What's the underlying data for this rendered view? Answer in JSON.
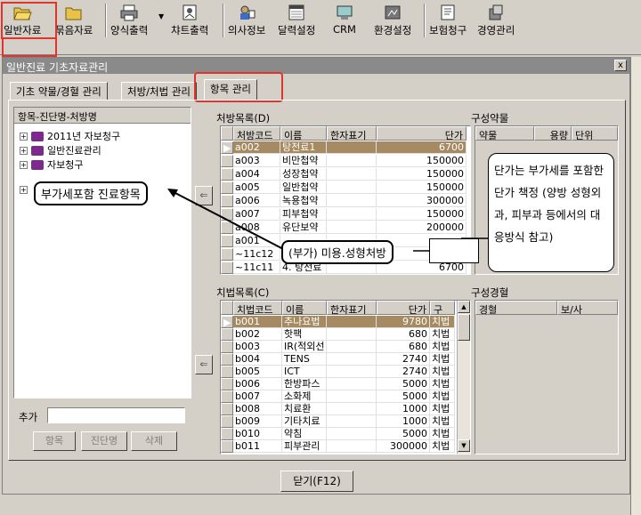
{
  "toolbar": {
    "items": [
      {
        "label": "일반자료",
        "icon": "folder-open-icon"
      },
      {
        "label": "묶음자료",
        "icon": "folder-icon"
      },
      {
        "label": "양식출력",
        "icon": "printer-icon"
      },
      {
        "label": "챠트출력",
        "icon": "chart-print-icon"
      },
      {
        "label": "의사정보",
        "icon": "doctor-icon"
      },
      {
        "label": "달력설정",
        "icon": "calendar-icon"
      },
      {
        "label": "CRM",
        "icon": "crm-icon"
      },
      {
        "label": "환경설정",
        "icon": "settings-icon"
      },
      {
        "label": "보험청구",
        "icon": "insurance-claim-icon"
      },
      {
        "label": "경영관리",
        "icon": "management-icon"
      }
    ]
  },
  "window": {
    "title": "일반진료 기초자료관리",
    "close": "x",
    "tabs": [
      "기초 약물/경혈 관리",
      "처방/처법 관리",
      "항목 관리"
    ],
    "active_tab": "항목 관리",
    "close_button": "닫기(F12)"
  },
  "tree": {
    "header": "항목-진단명-처방명",
    "nodes": [
      "2011년 자보청구",
      "일반진료관리",
      "자보청구"
    ],
    "add_label": "추가",
    "add_value": "",
    "buttons": [
      "항목",
      "진단명",
      "삭제"
    ]
  },
  "prescriptions": {
    "title": "처방목록(D)",
    "columns": [
      "처방코드",
      "이름",
      "한자표기",
      "단가"
    ],
    "rows": [
      {
        "code": "a002",
        "name": "탕전료1",
        "hanja": "",
        "price": "6700"
      },
      {
        "code": "a003",
        "name": "비만첩약",
        "hanja": "",
        "price": "150000"
      },
      {
        "code": "a004",
        "name": "성장첩약",
        "hanja": "",
        "price": "150000"
      },
      {
        "code": "a005",
        "name": "일반첩약",
        "hanja": "",
        "price": "150000"
      },
      {
        "code": "a006",
        "name": "녹용첩약",
        "hanja": "",
        "price": "300000"
      },
      {
        "code": "a007",
        "name": "피부첩약",
        "hanja": "",
        "price": "150000"
      },
      {
        "code": "a008",
        "name": "유단보약",
        "hanja": "",
        "price": "200000"
      },
      {
        "code": "a001",
        "name": "",
        "hanja": "",
        "price": ""
      },
      {
        "code": "~11c12",
        "name": "",
        "hanja": "",
        "price": ""
      },
      {
        "code": "~11c11",
        "name": "4. 탕전료",
        "hanja": "",
        "price": "6700"
      }
    ]
  },
  "composition_drugs": {
    "title": "구성약물",
    "columns": [
      "약물",
      "용량",
      "단위"
    ]
  },
  "treatments": {
    "title": "치법목록(C)",
    "columns": [
      "치법코드",
      "이름",
      "한자표기",
      "단가",
      "구"
    ],
    "rows": [
      {
        "code": "b001",
        "name": "추나요법",
        "hanja": "",
        "price": "9780",
        "type": "치법"
      },
      {
        "code": "b002",
        "name": "핫팩",
        "hanja": "",
        "price": "680",
        "type": "치법"
      },
      {
        "code": "b003",
        "name": "IR(적외선",
        "hanja": "",
        "price": "680",
        "type": "치법"
      },
      {
        "code": "b004",
        "name": "TENS",
        "hanja": "",
        "price": "2740",
        "type": "치법"
      },
      {
        "code": "b005",
        "name": "ICT",
        "hanja": "",
        "price": "2740",
        "type": "치법"
      },
      {
        "code": "b006",
        "name": "한방파스",
        "hanja": "",
        "price": "5000",
        "type": "치법"
      },
      {
        "code": "b007",
        "name": "소화제",
        "hanja": "",
        "price": "5000",
        "type": "치법"
      },
      {
        "code": "b008",
        "name": "치료환",
        "hanja": "",
        "price": "1000",
        "type": "치법"
      },
      {
        "code": "b009",
        "name": "기타치료",
        "hanja": "",
        "price": "1000",
        "type": "치법"
      },
      {
        "code": "b010",
        "name": "약침",
        "hanja": "",
        "price": "5000",
        "type": "치법"
      },
      {
        "code": "b011",
        "name": "피부관리",
        "hanja": "",
        "price": "300000",
        "type": "치법"
      }
    ]
  },
  "composition_points": {
    "title": "구성경혈",
    "columns": [
      "경혈",
      "보/사"
    ]
  },
  "annotations": {
    "tax_included": "부가세포함 진료항목",
    "cosmetic": "(부가) 미용.성형처방",
    "price_note": "단가는 부가세를 포함한 단가 책정 (양방 성형외과, 피부과 등에서의 대응방식 참고)"
  },
  "colors": {
    "selected_row": "#a58a62",
    "highlight": "#e0342c"
  }
}
